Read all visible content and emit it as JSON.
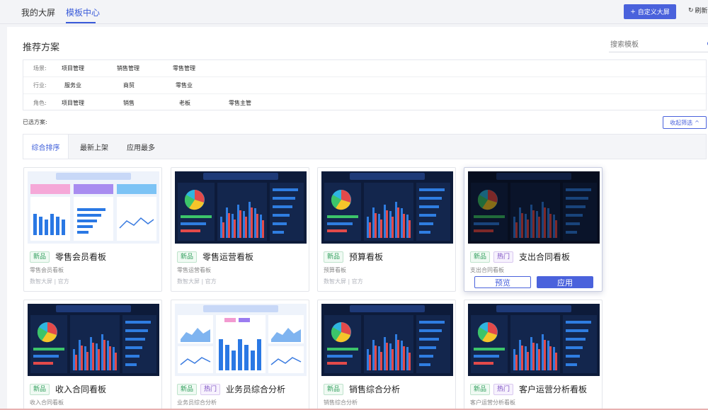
{
  "topbar": {
    "tabs": [
      {
        "label": "我的大屏"
      },
      {
        "label": "模板中心"
      }
    ],
    "custom_button": "自定义大屏",
    "refresh_button": "刷新"
  },
  "recommend": {
    "title": "推荐方案",
    "search_placeholder": "搜索模板"
  },
  "filters": {
    "rows": [
      {
        "label": "场景:",
        "options": [
          "项目管理",
          "销售管理",
          "零售管理"
        ]
      },
      {
        "label": "行业:",
        "options": [
          "服务业",
          "商贸",
          "零售业"
        ]
      },
      {
        "label": "角色:",
        "options": [
          "项目管理",
          "销售",
          "老板",
          "零售主管"
        ]
      }
    ],
    "selected_label": "已选方案:",
    "collapse_button": "收起筛选"
  },
  "sort_tabs": [
    "综合排序",
    "最新上架",
    "应用最多"
  ],
  "cards": [
    {
      "tags": [
        "新品"
      ],
      "title": "零售会员看板",
      "sub": "零售会员看板",
      "meta": "数智大屏 | 官方",
      "thumb_title": "零售会员看板",
      "theme": "light"
    },
    {
      "tags": [
        "新品"
      ],
      "title": "零售运营看板",
      "sub": "零售运营看板",
      "meta": "数智大屏 | 官方",
      "thumb_title": "零售运营看板",
      "theme": "dark"
    },
    {
      "tags": [
        "新品"
      ],
      "title": "预算看板",
      "sub": "预算看板",
      "meta": "数智大屏 | 官方",
      "thumb_title": "预算看板",
      "theme": "dark"
    },
    {
      "tags": [
        "新品",
        "热门"
      ],
      "title": "支出合同看板",
      "sub": "支出合同看板",
      "meta": "",
      "thumb_title": "支出合同看板",
      "theme": "dark",
      "hover": true,
      "preview_button": "预览",
      "apply_button": "应用"
    },
    {
      "tags": [
        "新品"
      ],
      "title": "收入合同看板",
      "sub": "收入合同看板",
      "meta": "",
      "thumb_title": "收入合同看板",
      "theme": "dark"
    },
    {
      "tags": [
        "新品",
        "热门"
      ],
      "title": "业务员综合分析",
      "sub": "业务员综合分析",
      "meta": "",
      "thumb_title": "业务员综合分析",
      "theme": "light"
    },
    {
      "tags": [
        "新品"
      ],
      "title": "销售综合分析",
      "sub": "销售综合分析",
      "meta": "",
      "thumb_title": "销售综合分析",
      "theme": "dark"
    },
    {
      "tags": [
        "新品",
        "热门"
      ],
      "title": "客户运营分析看板",
      "sub": "客户运营分析看板",
      "meta": "",
      "thumb_title": "客户运营分析",
      "theme": "dark"
    }
  ]
}
